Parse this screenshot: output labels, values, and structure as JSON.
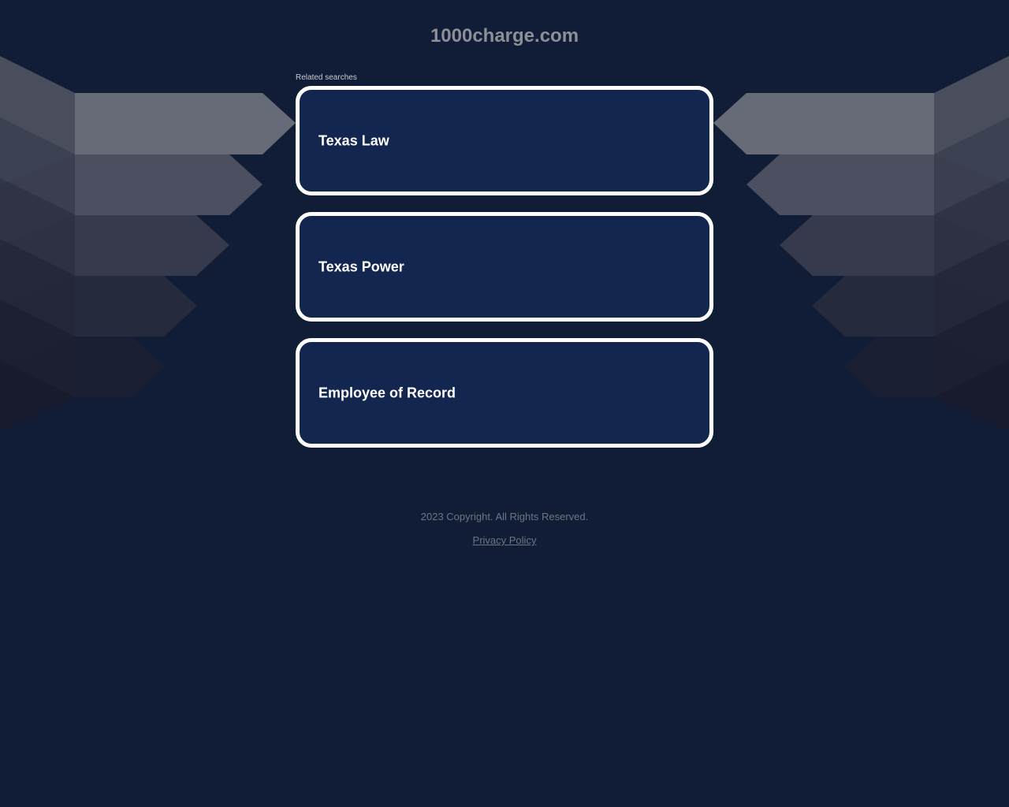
{
  "site": {
    "domain": "1000charge.com"
  },
  "related": {
    "label": "Related searches",
    "items": [
      {
        "label": "Texas Law"
      },
      {
        "label": "Texas Power"
      },
      {
        "label": "Employee of Record"
      }
    ]
  },
  "footer": {
    "copyright": "2023 Copyright. All Rights Reserved.",
    "privacy_label": "Privacy Policy"
  },
  "colors": {
    "background": "#111d37",
    "card_fill": "#12264f",
    "card_border": "#ffffff",
    "title_text": "#8c8f96",
    "footer_text": "#6f7480"
  }
}
